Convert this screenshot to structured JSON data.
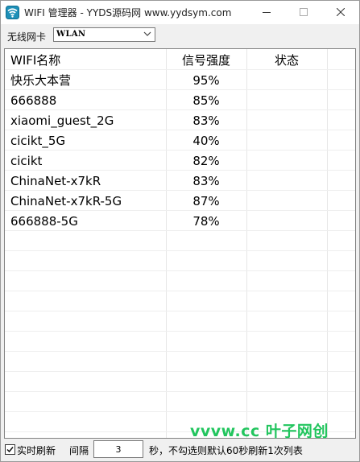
{
  "window": {
    "title": "WIFI 管理器  -  YYDS源码网 www.yydsym.com"
  },
  "toolbar": {
    "adapter_label": "无线网卡",
    "adapter_value": "WLAN"
  },
  "list": {
    "columns": [
      "WIFI名称",
      "信号强度",
      "状态"
    ],
    "rows": [
      {
        "name": "快乐大本营",
        "signal": "95%",
        "status": ""
      },
      {
        "name": "666888",
        "signal": "85%",
        "status": ""
      },
      {
        "name": "xiaomi_guest_2G",
        "signal": "83%",
        "status": ""
      },
      {
        "name": "cicikt_5G",
        "signal": "40%",
        "status": ""
      },
      {
        "name": "cicikt",
        "signal": "82%",
        "status": ""
      },
      {
        "name": "ChinaNet-x7kR",
        "signal": "83%",
        "status": ""
      },
      {
        "name": "ChinaNet-x7kR-5G",
        "signal": "87%",
        "status": ""
      },
      {
        "name": "666888-5G",
        "signal": "78%",
        "status": ""
      }
    ]
  },
  "statusbar": {
    "auto_refresh_label": "实时刷新",
    "auto_refresh_checked": true,
    "interval_label": "间隔",
    "interval_value": "3",
    "hint": "秒，不勾选则默认60秒刷新1次列表"
  },
  "watermark": "vvvw.cc 叶子网创",
  "icons": {
    "app": "wifi-manager-app-icon",
    "minimize": "minimize-icon",
    "maximize": "maximize-icon",
    "close": "close-icon",
    "dropdown": "chevron-down-icon",
    "check": "check-icon"
  },
  "colors": {
    "app_icon": "#1e90b8",
    "watermark": "#22c55e",
    "window_bg": "#f0f0f0"
  }
}
